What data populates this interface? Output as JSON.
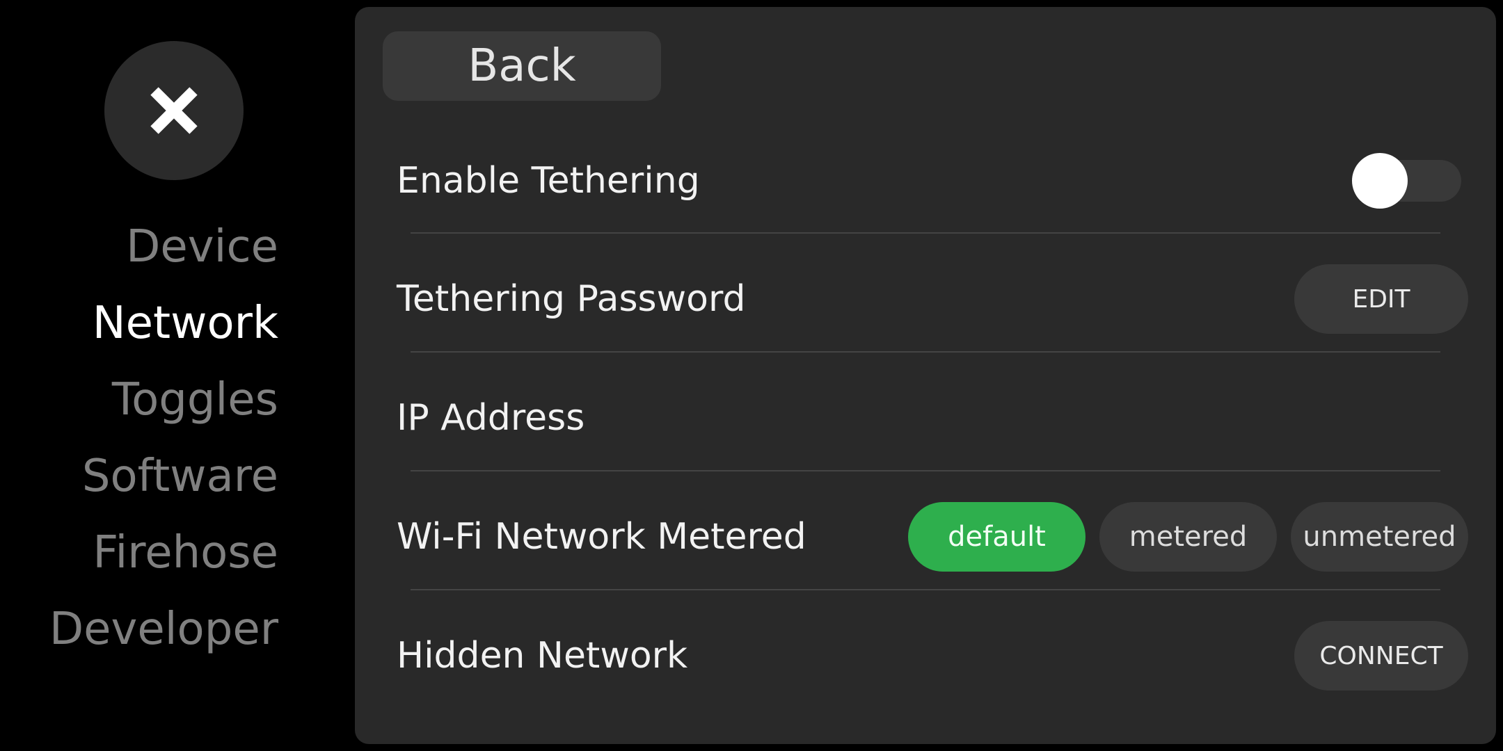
{
  "sidebar": {
    "close_icon": "close-icon",
    "items": [
      {
        "label": "Device",
        "active": false
      },
      {
        "label": "Network",
        "active": true
      },
      {
        "label": "Toggles",
        "active": false
      },
      {
        "label": "Software",
        "active": false
      },
      {
        "label": "Firehose",
        "active": false
      },
      {
        "label": "Developer",
        "active": false
      }
    ]
  },
  "panel": {
    "back_label": "Back",
    "tethering": {
      "label": "Enable Tethering",
      "enabled": false
    },
    "password": {
      "label": "Tethering Password",
      "button": "EDIT"
    },
    "ip": {
      "label": "IP Address",
      "value": ""
    },
    "metered": {
      "label": "Wi-Fi Network Metered",
      "options": [
        "default",
        "metered",
        "unmetered"
      ],
      "selected": "default",
      "selected_color": "#2eaf4d"
    },
    "hidden": {
      "label": "Hidden Network",
      "button": "CONNECT"
    }
  }
}
